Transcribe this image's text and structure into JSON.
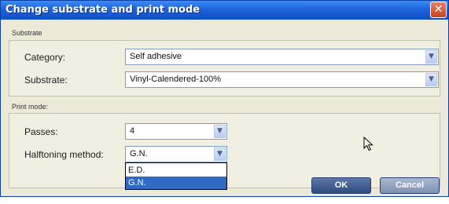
{
  "window": {
    "title": "Change substrate and print mode",
    "close_glyph": "✕"
  },
  "substrate_group": {
    "label": "Substrate",
    "category": {
      "label": "Category:",
      "value": "Self adhesive"
    },
    "substrate": {
      "label": "Substrate:",
      "value": "Vinyl-Calendered-100%"
    }
  },
  "print_mode_group": {
    "label": "Print mode:",
    "passes": {
      "label": "Passes:",
      "value": "4"
    },
    "halftoning": {
      "label": "Halftoning method:",
      "value": "G.N.",
      "options": [
        "E.D.",
        "G.N."
      ],
      "highlighted_option": "G.N."
    }
  },
  "buttons": {
    "ok": "OK",
    "cancel": "Cancel"
  },
  "icons": {
    "combo_arrow": "chevron-down-icon",
    "close": "close-icon",
    "cursor": "mouse-pointer-icon"
  },
  "colors": {
    "titlebar": "#1f63d9",
    "selection": "#316ac5",
    "ok_button": "#2f4a80",
    "cancel_button": "#7f91b2"
  }
}
